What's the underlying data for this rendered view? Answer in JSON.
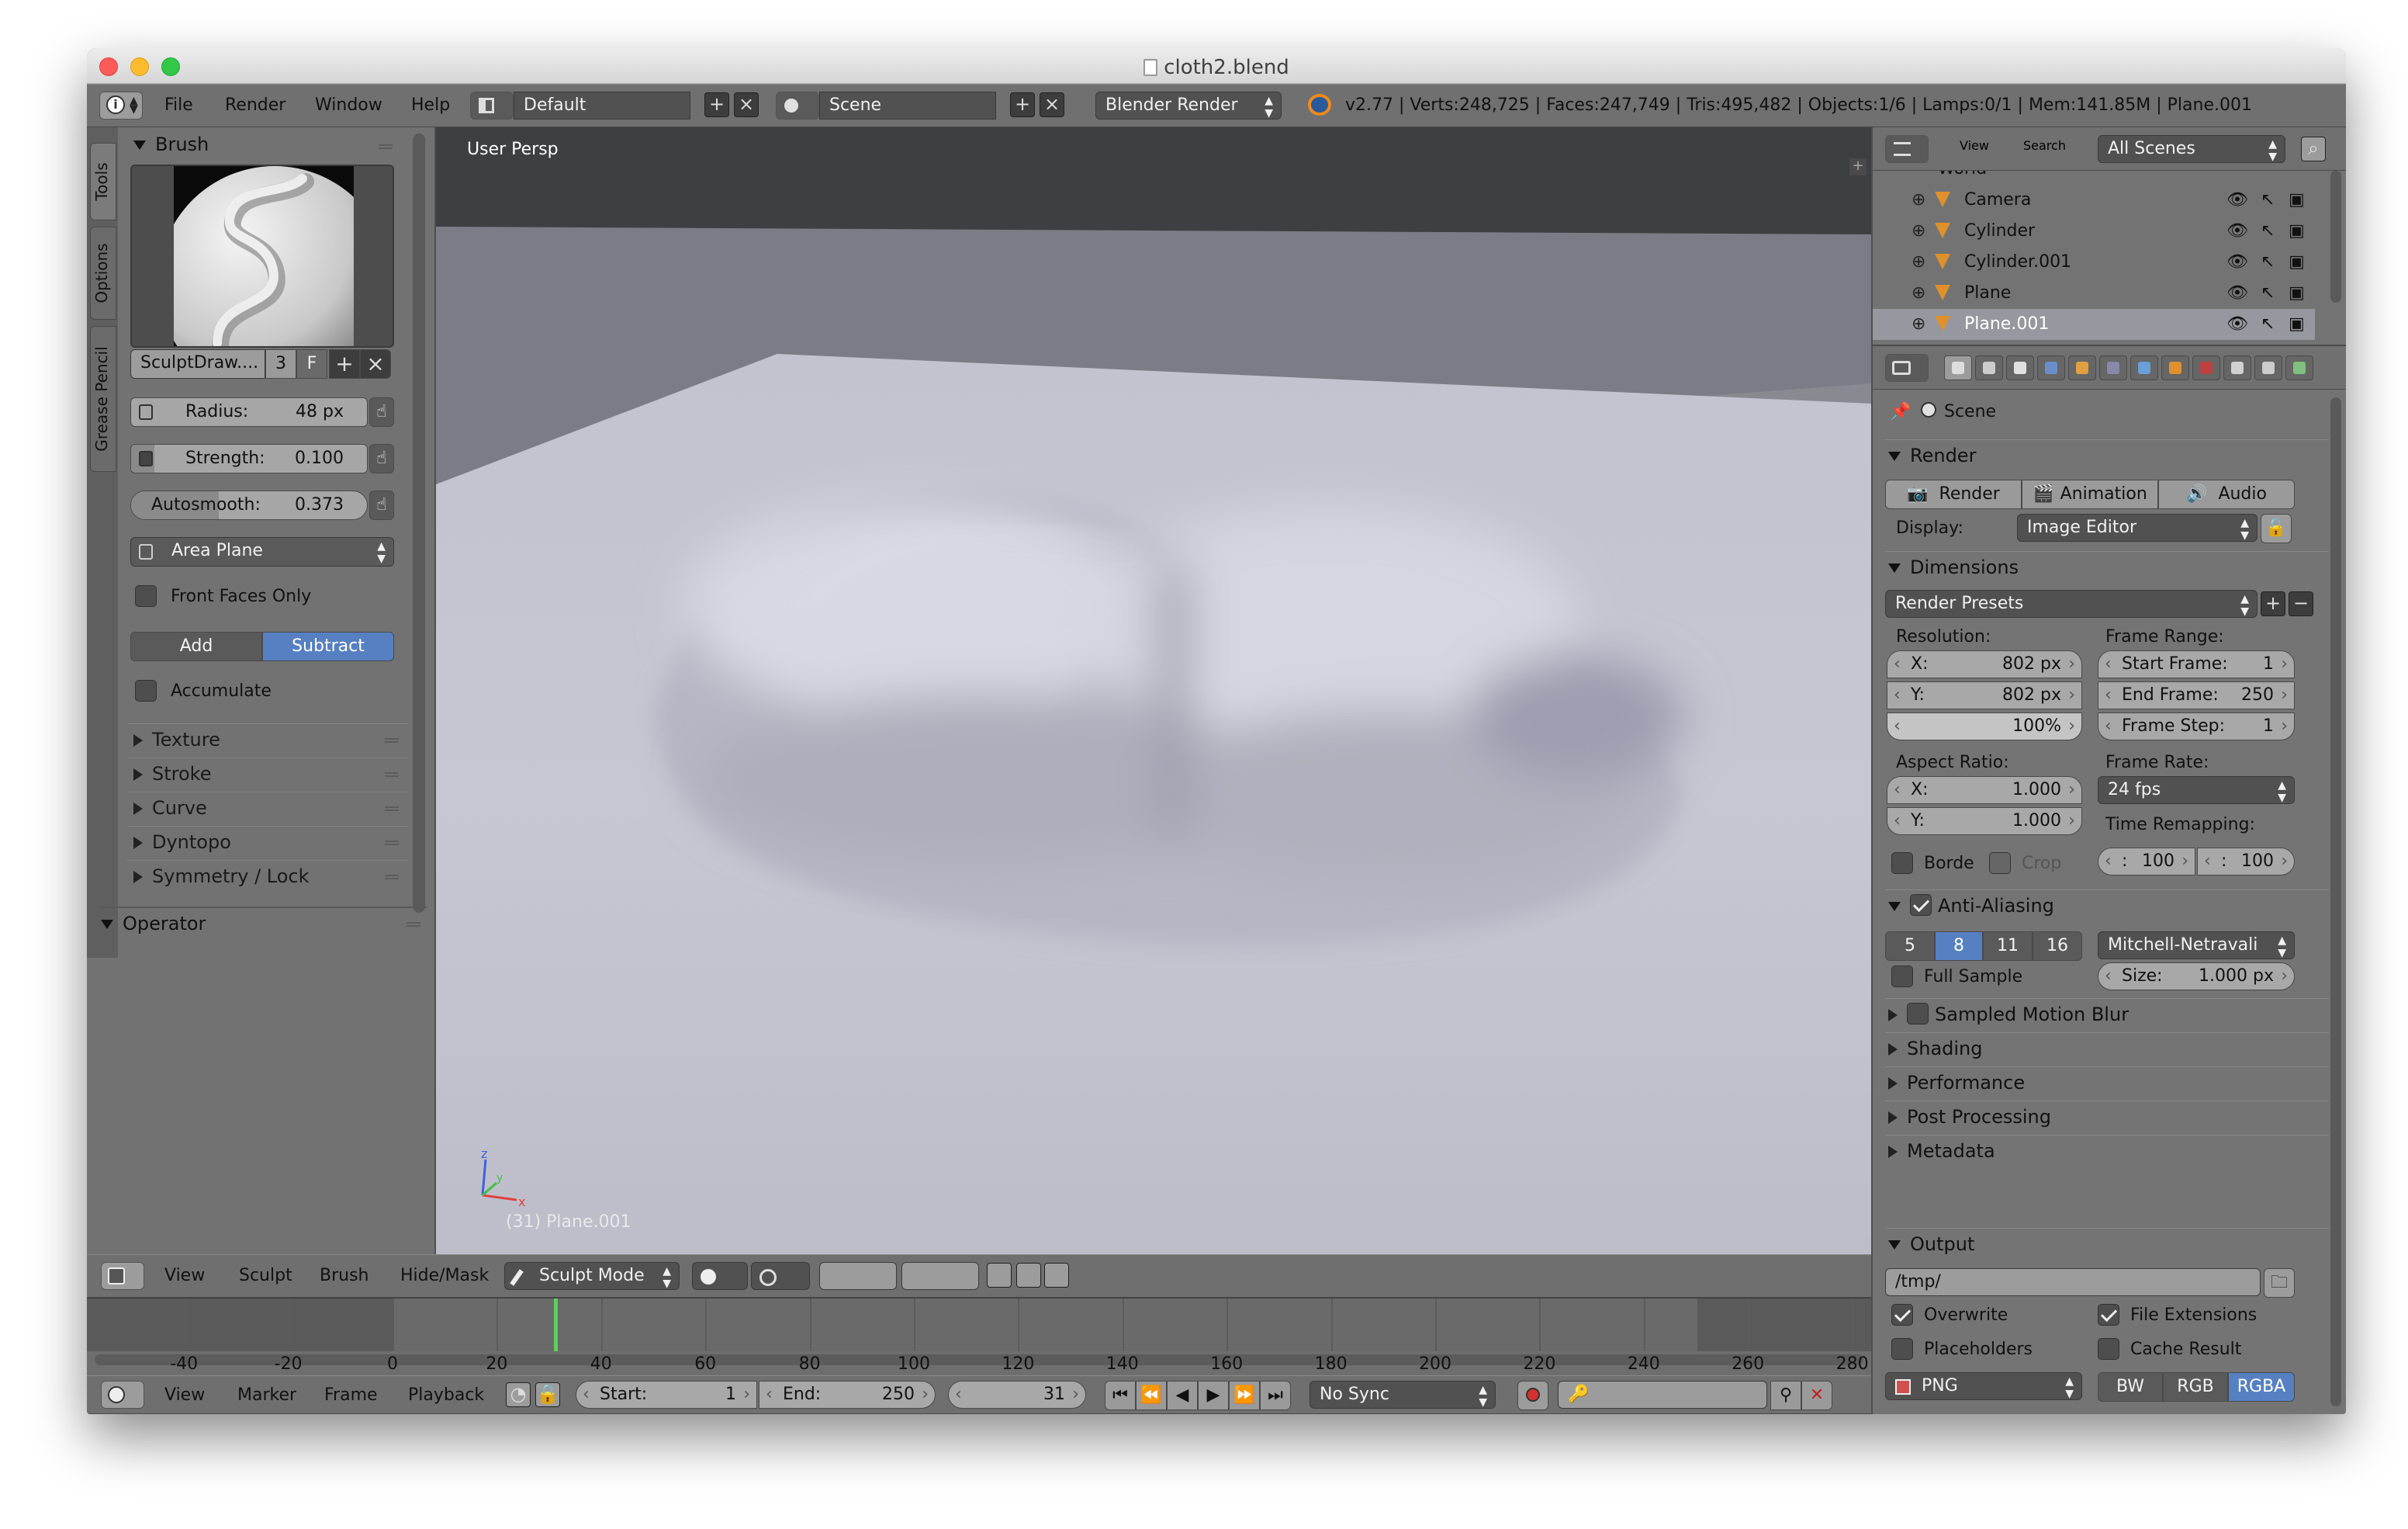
{
  "window": {
    "title": "cloth2.blend"
  },
  "info": {
    "menus": [
      "File",
      "Render",
      "Window",
      "Help"
    ],
    "layout": "Default",
    "scene": "Scene",
    "engine": "Blender Render",
    "stats": "v2.77 | Verts:248,725 | Faces:247,749 | Tris:495,482 | Objects:1/6 | Lamps:0/1 | Mem:141.85M | Plane.001"
  },
  "tool_tabs": [
    "Tools",
    "Options",
    "Grease Pencil"
  ],
  "brush": {
    "panel_title": "Brush",
    "name": "SculptDraw....",
    "users": "3",
    "fake": "F",
    "radius_label": "Radius:",
    "radius_value": "48 px",
    "strength_label": "Strength:",
    "strength_value": "0.100",
    "autosmooth_label": "Autosmooth:",
    "autosmooth_value": "0.373",
    "autosmooth_fill": 0.373,
    "strength_fill": 0.1,
    "sculpt_plane": "Area Plane",
    "front_faces": "Front Faces Only",
    "add": "Add",
    "subtract": "Subtract",
    "accumulate": "Accumulate"
  },
  "tool_sections": [
    "Texture",
    "Stroke",
    "Curve",
    "Dyntopo",
    "Symmetry / Lock"
  ],
  "operator": "Operator",
  "viewport": {
    "label": "User Persp",
    "object": "(31) Plane.001",
    "axis_x": "x",
    "axis_y": "y",
    "axis_z": "z"
  },
  "view_header": {
    "menus": [
      "View",
      "Sculpt",
      "Brush",
      "Hide/Mask"
    ],
    "mode": "Sculpt Mode"
  },
  "timeline": {
    "ticks": [
      "-40",
      "-20",
      "0",
      "20",
      "40",
      "60",
      "80",
      "100",
      "120",
      "140",
      "160",
      "180",
      "200",
      "220",
      "240",
      "260",
      "280"
    ],
    "current_frame": 31,
    "menus": [
      "View",
      "Marker",
      "Frame",
      "Playback"
    ],
    "start_label": "Start:",
    "start": "1",
    "end_label": "End:",
    "end": "250",
    "frame": "31",
    "sync": "No Sync"
  },
  "outliner": {
    "menus": [
      "View",
      "Search"
    ],
    "filter": "All Scenes",
    "partial_row": "World",
    "items": [
      "Camera",
      "Cylinder",
      "Cylinder.001",
      "Plane",
      "Plane.001"
    ],
    "selected": "Plane.001"
  },
  "properties": {
    "context": "Scene",
    "render_section": "Render",
    "render_btn": "Render",
    "animation_btn": "Animation",
    "audio_btn": "Audio",
    "display_label": "Display:",
    "display_value": "Image Editor",
    "dimensions_section": "Dimensions",
    "render_presets": "Render Presets",
    "resolution_label": "Resolution:",
    "res_x_label": "X:",
    "res_x": "802 px",
    "res_y_label": "Y:",
    "res_y": "802 px",
    "res_pct": "100%",
    "frame_range_label": "Frame Range:",
    "start_frame_label": "Start Frame:",
    "start_frame": "1",
    "end_frame_label": "End Frame:",
    "end_frame": "250",
    "frame_step_label": "Frame Step:",
    "frame_step": "1",
    "aspect_label": "Aspect Ratio:",
    "asp_x_label": "X:",
    "asp_x": "1.000",
    "asp_y_label": "Y:",
    "asp_y": "1.000",
    "frame_rate_label": "Frame Rate:",
    "frame_rate": "24 fps",
    "time_remap_label": "Time Remapping:",
    "remap_old": "100",
    "remap_new": "100",
    "border": "Borde",
    "crop": "Crop",
    "aa_section": "Anti-Aliasing",
    "aa_samples": [
      "5",
      "8",
      "11",
      "16"
    ],
    "aa_selected": "8",
    "aa_filter": "Mitchell-Netravali",
    "full_sample": "Full Sample",
    "size_label": "Size:",
    "size_value": "1.000 px",
    "sections": [
      "Sampled Motion Blur",
      "Shading",
      "Performance",
      "Post Processing",
      "Metadata"
    ],
    "output_section": "Output",
    "output_path": "/tmp/",
    "overwrite": "Overwrite",
    "file_ext": "File Extensions",
    "placeholders": "Placeholders",
    "cache_result": "Cache Result",
    "format": "PNG",
    "color_modes": [
      "BW",
      "RGB",
      "RGBA"
    ],
    "color_selected": "RGBA"
  }
}
